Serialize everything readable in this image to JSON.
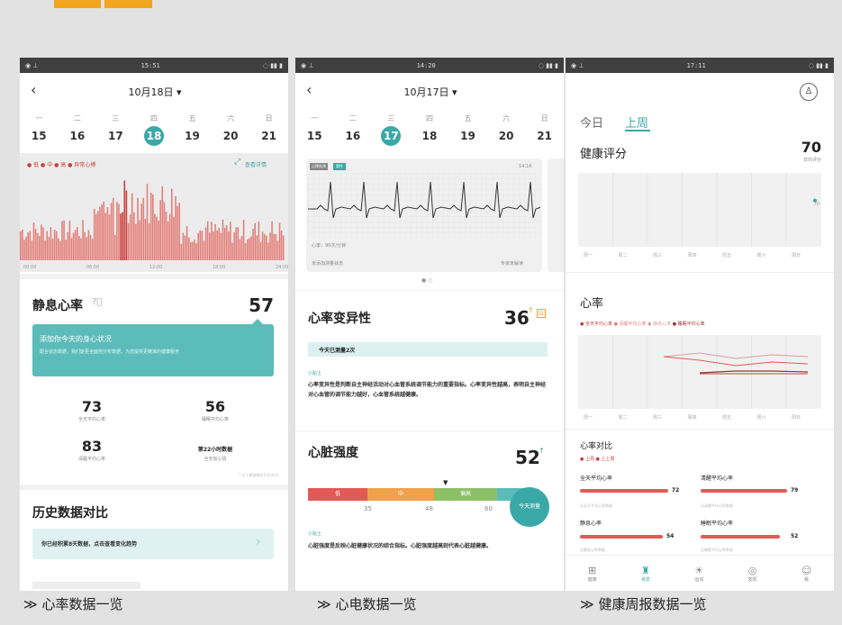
{
  "colors": {
    "accent": "#3aa8a6",
    "deco": "#f2a51e",
    "bar": "#e3807b",
    "bardark": "#c9403b"
  },
  "status": {
    "p1_time": "15:51",
    "p2_time": "14:20",
    "p3_time": "17:11"
  },
  "p1": {
    "date_title": "10月18日 ▾",
    "weekdays": [
      "一",
      "二",
      "三",
      "四",
      "五",
      "六",
      "日"
    ],
    "dates": [
      "15",
      "16",
      "17",
      "18",
      "19",
      "20",
      "21"
    ],
    "legend": "● 低 ● 中 ● 高 ● 异常心搏",
    "view_detail": "查看详情",
    "chart_xticks": [
      "00:00",
      "06:00",
      "12:00",
      "18:00",
      "24:00"
    ],
    "rest_label": "静息心率",
    "rest_value": "57",
    "banner_title": "添加你今天的身心状况",
    "banner_text": "配合状态数据，我们能更全面地分析数据，为您提供更精准的健康服务",
    "stats": [
      {
        "value": "73",
        "label": "全天平均心率"
      },
      {
        "value": "56",
        "label": "睡眠平均心率"
      },
      {
        "value": "83",
        "label": "清醒平均心率"
      },
      {
        "value": "第22小时数据",
        "label": "全天加心情"
      }
    ],
    "stats_note": "* 以上数据单位均为次/分",
    "history_title": "历史数据对比",
    "history_text": "你已经积累8天数据，点击查看变化趋势"
  },
  "p2": {
    "date_title": "10月17日 ▾",
    "weekdays": [
      "一",
      "二",
      "三",
      "四",
      "五",
      "六",
      "日"
    ],
    "dates": [
      "15",
      "16",
      "17",
      "18",
      "19",
      "20",
      "21"
    ],
    "ecg_tag1": "心律失常",
    "ecg_tag2": "窦性",
    "ecg_time": "14:16",
    "ecg_rate": "心率：90次/分钟",
    "ecg_state": "未添加测量状态",
    "ecg_expert": "专家未解读",
    "hrv_title": "心率变异性",
    "hrv_value": "36",
    "measured": "今天已测量2次",
    "tip_label": "小贴士",
    "hrv_tip": "心率变异性是判断自主神经活动对心血管系统调节能力的重要指标。心率变异性越高，表明自主神经对心血管的调节能力越好，心血管系统越健康。",
    "heart_title": "心脏强度",
    "heart_value": "52",
    "scale_labels": [
      "低",
      "中",
      "偏高"
    ],
    "scale_ticks": [
      "35",
      "48",
      "60"
    ],
    "measure_btn": "今天测量",
    "tip_label2": "小贴士",
    "heart_tip": "心脏强度是反映心脏健康状况的综合指标。心脏强度越高则代表心脏越健康。"
  },
  "p3": {
    "tab_today": "今日",
    "tab_week": "上周",
    "score_title": "健康评分",
    "score_value": "70",
    "score_sub": "日均评分",
    "score_chart_label": "70",
    "days": [
      "周一",
      "周二",
      "周三",
      "周四",
      "周五",
      "周六",
      "周日"
    ],
    "hr_title": "心率",
    "hr_legend": [
      "全天平均心率",
      "清醒平均心率",
      "静息心率",
      "睡眠平均心率"
    ],
    "compare_title": "心率对比",
    "compare_legend": "● 上周 ● 上上周",
    "cmp": [
      {
        "label": "全天平均心率",
        "value": "72",
        "sub": "无全天平均心率数据"
      },
      {
        "label": "清醒平均心率",
        "value": "79",
        "sub": "无清醒平均心率数据"
      },
      {
        "label": "静息心率",
        "value": "54",
        "sub": "无静息心率数据"
      },
      {
        "label": "睡眠平均心率",
        "value": "52",
        "sub": "无睡眠平均心率数据"
      }
    ],
    "nav": [
      "健康",
      "状态",
      "运动",
      "发现",
      "我"
    ]
  },
  "captions": [
    "≫ 心率数据一览",
    "≫ 心电数据一览",
    "≫ 健康周报数据一览"
  ]
}
